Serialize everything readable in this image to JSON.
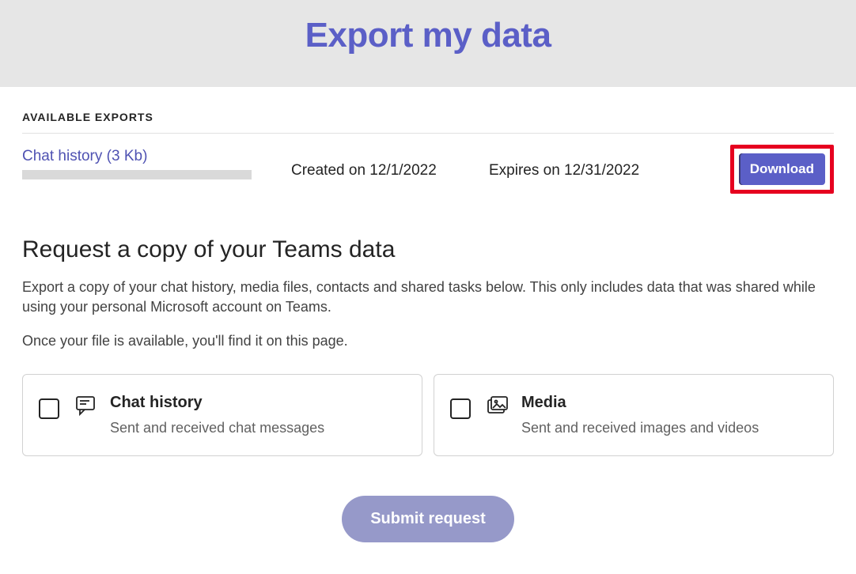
{
  "header": {
    "title": "Export my data"
  },
  "exports": {
    "section_label": "AVAILABLE EXPORTS",
    "items": [
      {
        "name": "Chat history (3 Kb)",
        "created_label": "Created on 12/1/2022",
        "expires_label": "Expires on 12/31/2022",
        "download_label": "Download"
      }
    ]
  },
  "request": {
    "heading": "Request a copy of your Teams data",
    "desc_line1": "Export a copy of your chat history, media files, contacts and shared tasks below. This only includes data that was shared while using your personal Microsoft account on Teams.",
    "desc_line2": "Once your file is available, you'll find it on this page."
  },
  "options": [
    {
      "title": "Chat history",
      "subtitle": "Sent and received chat messages"
    },
    {
      "title": "Media",
      "subtitle": "Sent and received images and videos"
    }
  ],
  "submit": {
    "label": "Submit request"
  }
}
